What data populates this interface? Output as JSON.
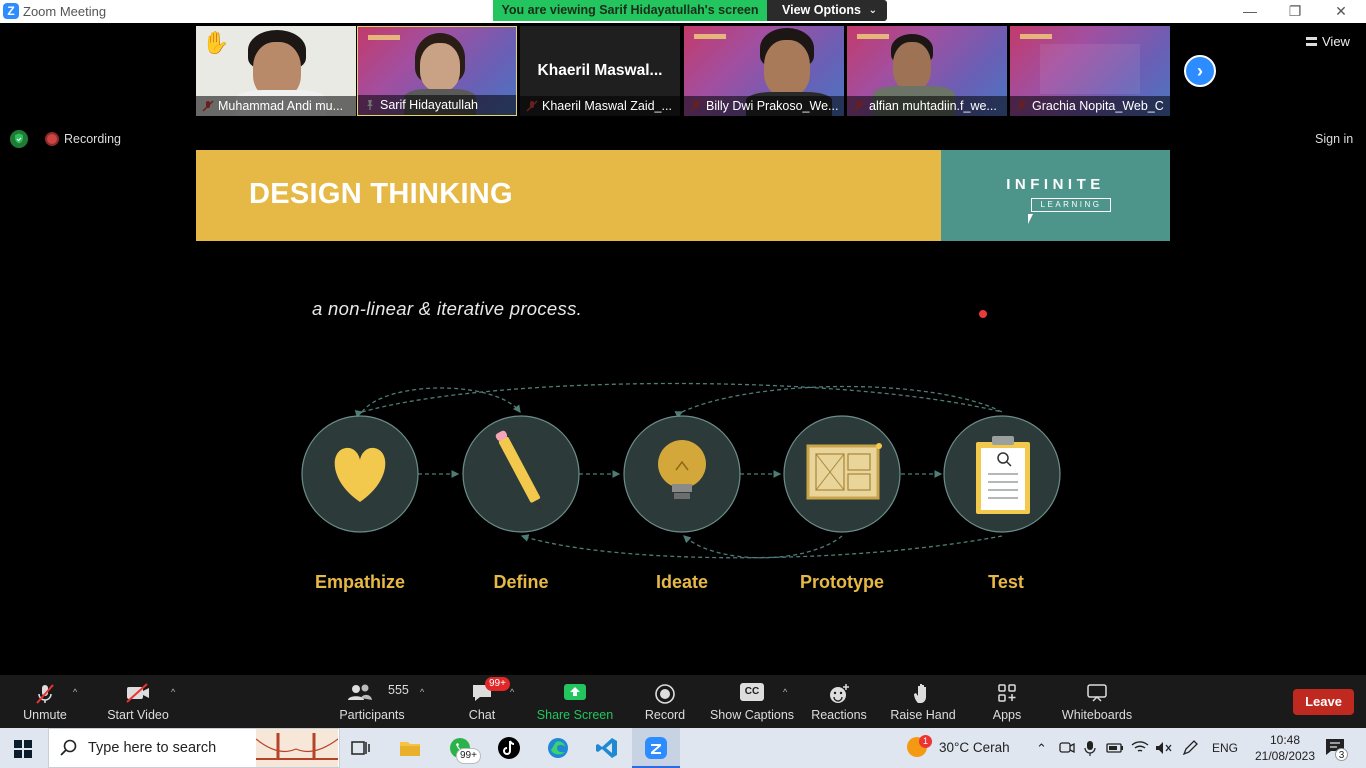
{
  "window": {
    "app_letter": "Z",
    "title": "Zoom Meeting",
    "banner": "You are viewing Sarif Hidayatullah's screen",
    "view_options": "View Options",
    "minimize": "—",
    "restore": "❐",
    "close": "✕"
  },
  "gallery": {
    "tiles": [
      {
        "name": "Muhammad Andi mu..."
      },
      {
        "name": "Sarif Hidayatullah"
      },
      {
        "name": "Khaeril Maswal Zaid_...",
        "big_label": "Khaeril  Maswal..."
      },
      {
        "name": "Billy Dwi Prakoso_We..."
      },
      {
        "name": "alfian muhtadiin.f_we..."
      },
      {
        "name": "Grachia Nopita_Web_C"
      }
    ],
    "view_label": "View"
  },
  "status": {
    "recording_label": "Recording",
    "sign_in": "Sign in"
  },
  "slide": {
    "title": "DESIGN THINKING",
    "logo_word": "INFINITE",
    "logo_sub": "LEARNING",
    "subtitle": "a non-linear & iterative process.",
    "stages": [
      "Empathize",
      "Define",
      "Ideate",
      "Prototype",
      "Test"
    ],
    "colors": {
      "header": "#e6b947",
      "logo_bg": "#4d958b",
      "circle": "#2c3b3a",
      "label": "#e6b947"
    }
  },
  "toolbar": {
    "unmute": "Unmute",
    "start_video": "Start Video",
    "participants": "Participants",
    "participants_count": "555",
    "chat": "Chat",
    "chat_badge": "99+",
    "share_screen": "Share Screen",
    "record": "Record",
    "show_captions": "Show Captions",
    "captions_icon": "CC",
    "reactions": "Reactions",
    "raise_hand": "Raise Hand",
    "apps": "Apps",
    "whiteboards": "Whiteboards",
    "leave": "Leave",
    "caret": "^"
  },
  "taskbar": {
    "search_placeholder": "Type here to search",
    "whatsapp_badge": "99+",
    "weather": "30°C  Cerah",
    "weather_badge": "1",
    "language": "ENG",
    "time": "10:48",
    "date": "21/08/2023",
    "notifications": "3"
  }
}
